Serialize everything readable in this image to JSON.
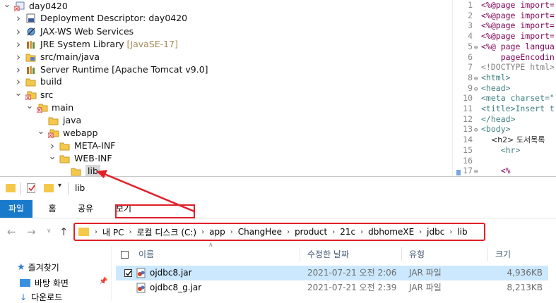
{
  "project_tree": {
    "items": [
      {
        "label": "day0420",
        "decoration": "",
        "twisty": "v",
        "icon": "project-icon"
      },
      {
        "label": "Deployment Descriptor: day0420",
        "decoration": "",
        "twisty": ">",
        "icon": "deployment-descriptor-icon"
      },
      {
        "label": "JAX-WS Web Services",
        "decoration": "",
        "twisty": ">",
        "icon": "web-services-icon"
      },
      {
        "label": "JRE System Library",
        "decoration": "[JavaSE-17]",
        "twisty": ">",
        "icon": "library-icon"
      },
      {
        "label": "src/main/java",
        "decoration": "",
        "twisty": ">",
        "icon": "source-folder-icon"
      },
      {
        "label": "Server Runtime [Apache Tomcat v9.0]",
        "decoration": "",
        "twisty": ">",
        "icon": "library-icon"
      },
      {
        "label": "build",
        "decoration": "",
        "twisty": ">",
        "icon": "folder-icon"
      },
      {
        "label": "src",
        "decoration": "",
        "twisty": "v",
        "icon": "folder-error-icon"
      },
      {
        "label": "main",
        "decoration": "",
        "twisty": "v",
        "icon": "folder-error-icon"
      },
      {
        "label": "java",
        "decoration": "",
        "twisty": "",
        "icon": "open-folder-icon"
      },
      {
        "label": "webapp",
        "decoration": "",
        "twisty": "v",
        "icon": "folder-error-icon"
      },
      {
        "label": "META-INF",
        "decoration": "",
        "twisty": ">",
        "icon": "open-folder-icon"
      },
      {
        "label": "WEB-INF",
        "decoration": "",
        "twisty": "v",
        "icon": "open-folder-icon"
      },
      {
        "label": "lib",
        "decoration": "",
        "twisty": "",
        "icon": "open-folder-icon"
      }
    ]
  },
  "editor": {
    "lines": [
      {
        "num": "1",
        "fold": "",
        "text": "<%@page import=",
        "style": "dir"
      },
      {
        "num": "2",
        "fold": "",
        "text": "<%@page import=",
        "style": "dir"
      },
      {
        "num": "3",
        "fold": "",
        "text": "<%@page import=",
        "style": "dir"
      },
      {
        "num": "4",
        "fold": "",
        "text": "<%@page import=",
        "style": "dir"
      },
      {
        "num": "5",
        "fold": "⊖",
        "text": "<%@ page langua",
        "style": "dir"
      },
      {
        "num": "6",
        "fold": "",
        "text": "    pageEncodin",
        "style": "dir"
      },
      {
        "num": "7",
        "fold": "",
        "text": "<!DOCTYPE html>",
        "style": "dim"
      },
      {
        "num": "8",
        "fold": "⊖",
        "text": "<html>",
        "style": "tag"
      },
      {
        "num": "9",
        "fold": "⊖",
        "text": "<head>",
        "style": "tag"
      },
      {
        "num": "10",
        "fold": "",
        "text": "<meta charset=\"",
        "style": "tag"
      },
      {
        "num": "11",
        "fold": "",
        "text": "<title>Insert t",
        "style": "tag"
      },
      {
        "num": "12",
        "fold": "",
        "text": "</head>",
        "style": "tag"
      },
      {
        "num": "13",
        "fold": "⊖",
        "text": "<body>",
        "style": "tag"
      },
      {
        "num": "14",
        "fold": "",
        "text": "    <h2> 도서목록",
        "style": "kr"
      },
      {
        "num": "15",
        "fold": "",
        "text": "    <hr>",
        "style": "tag"
      },
      {
        "num": "16",
        "fold": "",
        "text": "",
        "style": "tag"
      },
      {
        "num": "17",
        "fold": "⊖",
        "text": "    <%",
        "style": "dir"
      }
    ]
  },
  "explorer": {
    "title": "lib",
    "ribbon_tabs": [
      "파일",
      "홈",
      "공유",
      "보기"
    ],
    "address_crumbs": [
      "내 PC",
      "로컬 디스크 (C:)",
      "app",
      "ChangHee",
      "product",
      "21c",
      "dbhomeXE",
      "jdbc",
      "lib"
    ],
    "columns": {
      "name": "이름",
      "modified": "수정한 날짜",
      "type": "유형",
      "size": "크기"
    },
    "nav_items": [
      "즐겨찾기",
      "바탕 화면",
      "다운로드"
    ],
    "files": [
      {
        "name": "ojdbc8.jar",
        "modified": "2021-07-21 오전 2:06",
        "type": "JAR 파일",
        "size": "4,936KB",
        "selected": true
      },
      {
        "name": "ojdbc8_g.jar",
        "modified": "2021-07-21 오전 2:39",
        "type": "JAR 파일",
        "size": "8,213KB",
        "selected": false
      }
    ]
  },
  "colors": {
    "annotation_red": "#e0202a",
    "ribbon_accent": "#1979ca",
    "selection": "#cce8ff",
    "folder_yellow": "#f4c84a"
  }
}
